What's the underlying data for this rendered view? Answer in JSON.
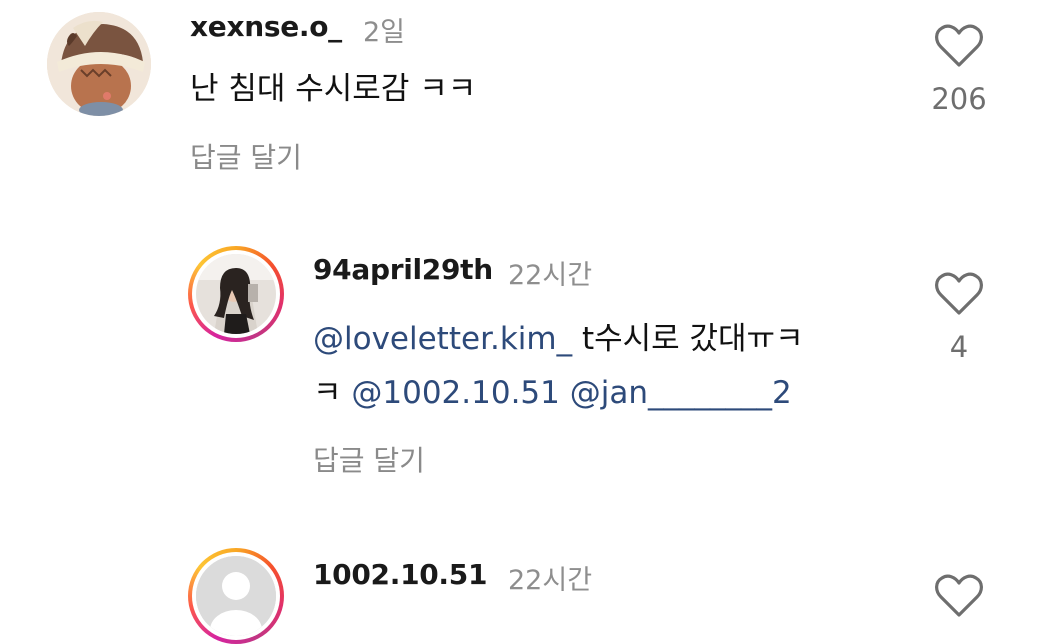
{
  "comments": [
    {
      "username": "xexnse.o_",
      "time": "2일",
      "text": "난 침대 수시로감 ㅋㅋ",
      "likes": "206",
      "reply_label": "답글 달기",
      "avatar": "cartoon-character-avatar"
    },
    {
      "username": "94april29th",
      "time": "22시간",
      "line1": {
        "mention": "@loveletter.kim_",
        "text": " t수시로 갔대ㅠㅋ"
      },
      "line2": {
        "text": "ㅋ ",
        "mention1": "@1002.10.51",
        "space": " ",
        "mention2": "@jan________2"
      },
      "likes": "4",
      "reply_label": "답글 달기",
      "avatar": "photo-avatar",
      "story_ring": true
    },
    {
      "username": "1002.10.51",
      "time": "22시간",
      "avatar": "default-avatar",
      "story_ring": true
    }
  ],
  "colors": {
    "mention": "#2d4a7a",
    "secondary_text": "#8e8e8e",
    "heart_outline": "#6e6e6e"
  }
}
